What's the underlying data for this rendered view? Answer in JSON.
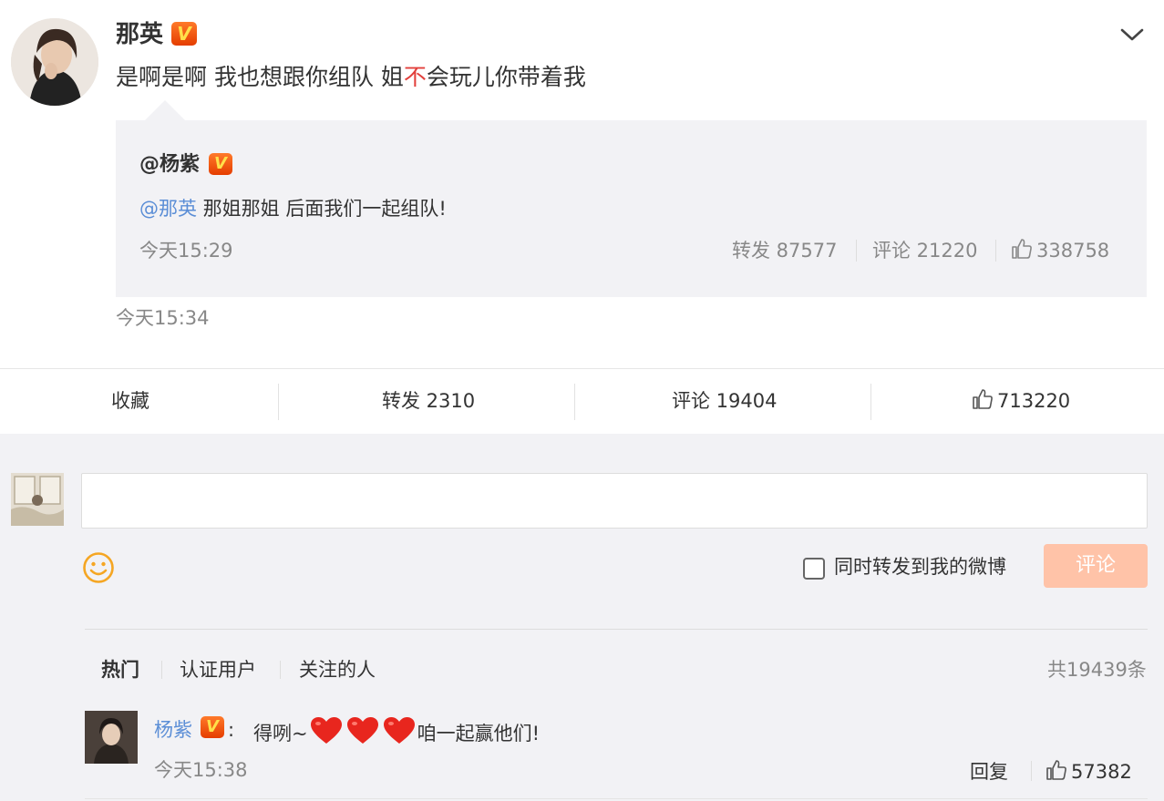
{
  "post": {
    "author": "那英",
    "verified_badge": "V",
    "text_before": "是啊是啊 我也想跟你组队 姐",
    "text_highlight": "不",
    "text_after": "会玩儿你带着我",
    "time": "今天15:34",
    "icons": {
      "more": "chevron-down-icon",
      "verified": "verified-v-icon"
    }
  },
  "repost": {
    "author": "@杨紫",
    "verified_badge": "V",
    "mention": "@那英",
    "text": " 那姐那姐 后面我们一起组队!",
    "time": "今天15:29",
    "forward": "转发 87577",
    "comment": "评论 21220",
    "likes": "338758"
  },
  "actions": {
    "favorite": "收藏",
    "forward": "转发 2310",
    "comment": "评论 19404",
    "likes": "713220"
  },
  "composer": {
    "placeholder": "",
    "also_forward_label": "同时转发到我的微博",
    "also_forward_checked": false,
    "submit_label": "评论",
    "icons": {
      "emoji": "smiley-icon"
    }
  },
  "filters": {
    "tabs": [
      "热门",
      "认证用户",
      "关注的人"
    ],
    "active": "热门",
    "total": "共19439条"
  },
  "comments": [
    {
      "author": "杨紫",
      "verified_badge": "V",
      "colon": ":",
      "text_before": "得咧~",
      "hearts": 3,
      "text_after": "咱一起赢他们!",
      "time": "今天15:38",
      "reply_label": "回复",
      "likes": "57382"
    }
  ],
  "colors": {
    "accent_orange": "#ff8140",
    "mention_blue": "#5b8ed6",
    "highlight_red": "#e2403c",
    "submit_disabled": "#ffc3a8",
    "page_bg": "#f2f2f5"
  }
}
